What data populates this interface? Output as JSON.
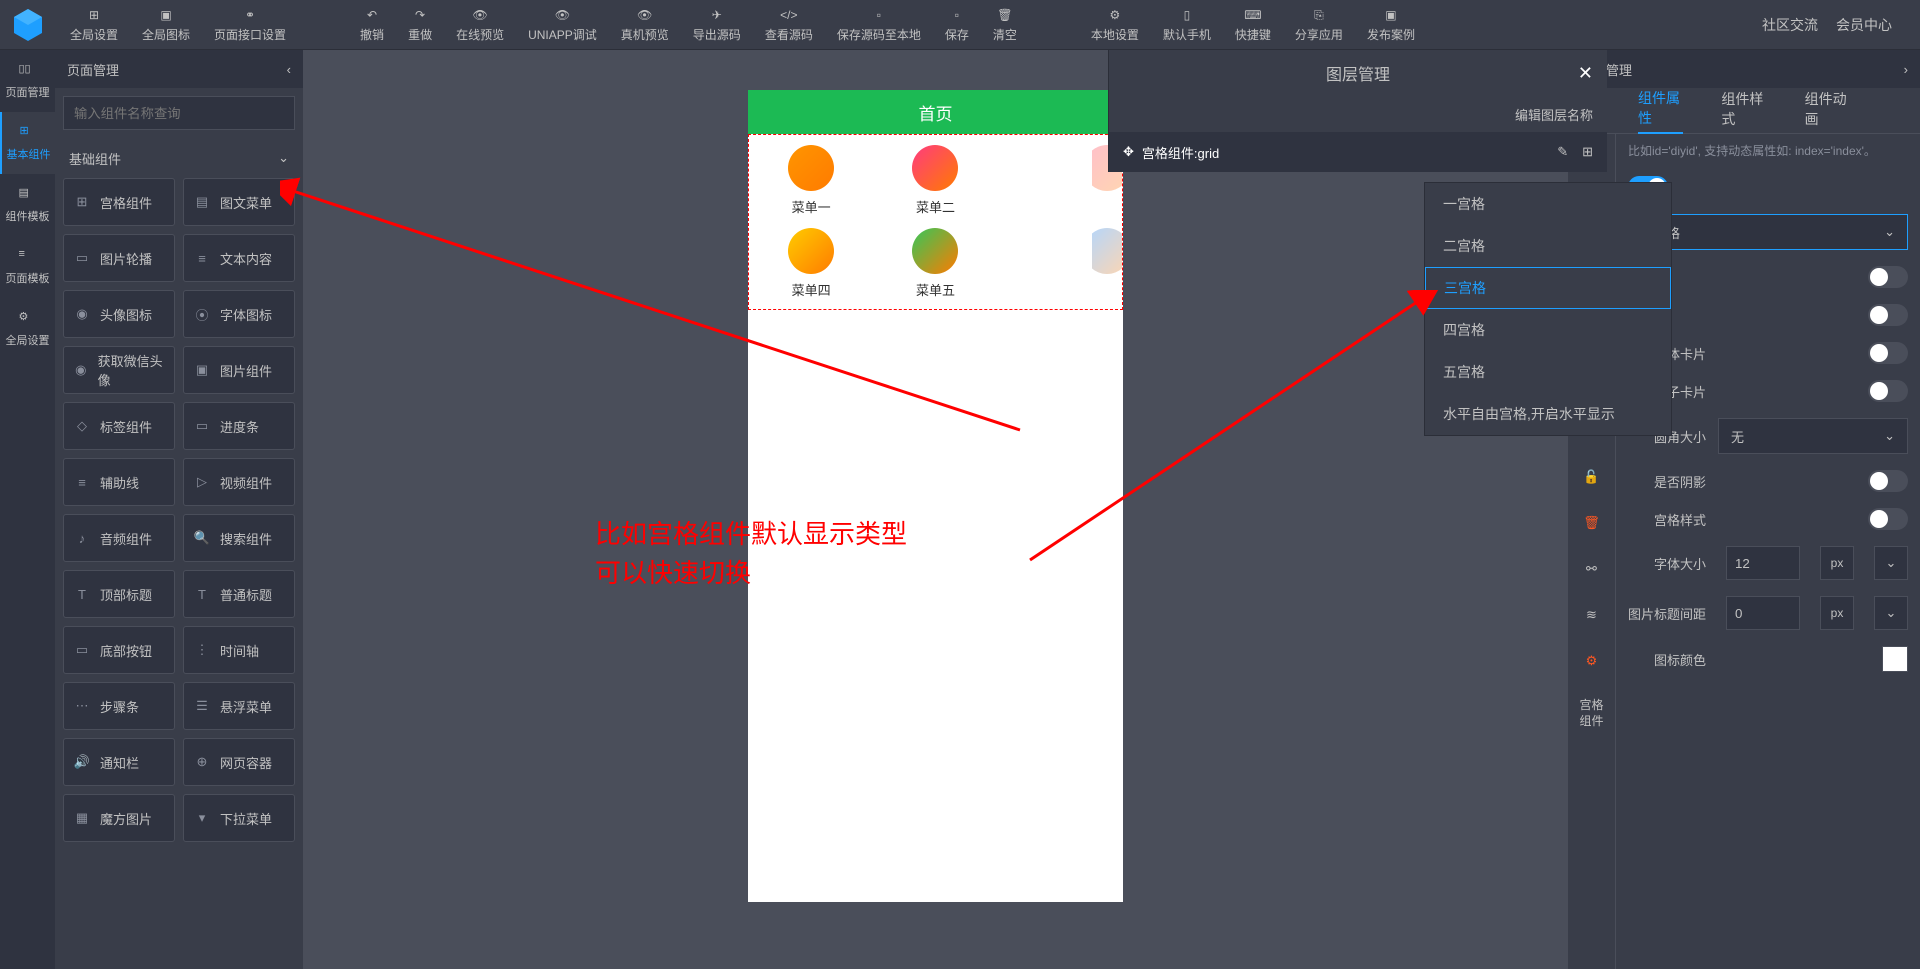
{
  "toolbar": {
    "items": [
      "全局设置",
      "全局图标",
      "页面接口设置"
    ],
    "actions": [
      "撤销",
      "重做",
      "在线预览",
      "UNIAPP调试",
      "真机预览",
      "导出源码",
      "查看源码",
      "保存源码至本地",
      "保存",
      "清空"
    ],
    "tools": [
      "本地设置",
      "默认手机",
      "快捷键",
      "分享应用",
      "发布案例"
    ],
    "right": [
      "社区交流",
      "会员中心"
    ]
  },
  "rail": [
    "页面管理",
    "基本组件",
    "组件模板",
    "页面模板",
    "全局设置"
  ],
  "leftPanel": {
    "title": "页面管理",
    "searchPlaceholder": "输入组件名称查询",
    "accordion": "基础组件",
    "components": [
      "宫格组件",
      "图文菜单",
      "图片轮播",
      "文本内容",
      "头像图标",
      "字体图标",
      "获取微信头像",
      "图片组件",
      "标签组件",
      "进度条",
      "辅助线",
      "视频组件",
      "音频组件",
      "搜索组件",
      "顶部标题",
      "普通标题",
      "底部按钮",
      "时间轴",
      "步骤条",
      "悬浮菜单",
      "通知栏",
      "网页容器",
      "魔方图片",
      "下拉菜单"
    ]
  },
  "phone": {
    "title": "首页",
    "cells": [
      "菜单一",
      "菜单二",
      "",
      "菜单四",
      "菜单五",
      ""
    ]
  },
  "annotation": [
    "比如宫格组件默认显示类型",
    "可以快速切换"
  ],
  "layer": {
    "title": "图层管理",
    "editLabel": "编辑图层名称",
    "row": "宫格组件:grid"
  },
  "dropdown": [
    "一宫格",
    "二宫格",
    "三宫格",
    "四宫格",
    "五宫格",
    "水平自由宫格,开启水平显示"
  ],
  "rightPanel": {
    "header": "属性管理",
    "tabs": [
      "组件属性",
      "组件样式",
      "组件动画"
    ],
    "note": "比如id='diyid', 支持动态属性如: index='index'。",
    "gridTypeValue": "三宫格",
    "labels": {
      "wholeCard": "整体卡片",
      "subCard": "子卡片",
      "radius": "圆角大小",
      "radiusValue": "无",
      "shadow": "是否阴影",
      "gridStyle": "宫格样式",
      "fontSize": "字体大小",
      "fontSizeValue": "12",
      "px": "px",
      "imgGap": "图片标题间距",
      "imgGapValue": "0",
      "titleColor": "图标颜色"
    },
    "railLabel": "宫格\n组件"
  }
}
